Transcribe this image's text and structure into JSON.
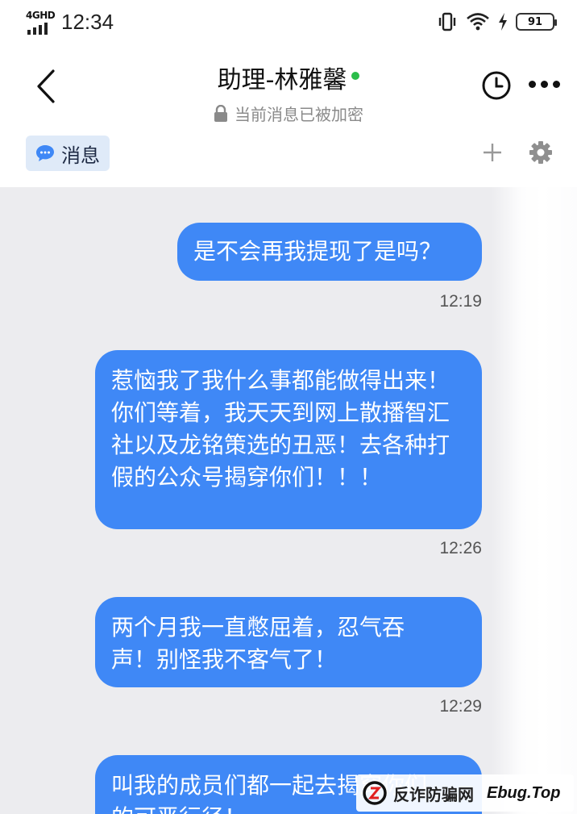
{
  "status_bar": {
    "network": "4GHD",
    "time": "12:34",
    "battery": "91"
  },
  "header": {
    "title": "助理-林雅馨",
    "subtitle": "当前消息已被加密"
  },
  "tabs": {
    "active_label": "消息"
  },
  "messages": [
    {
      "text": "是不会再我提现了是吗？",
      "time": "12:19"
    },
    {
      "text": "惹恼我了我什么事都能做得出来！你们等着，我天天到网上散播智汇社以及龙铭策选的丑恶！去各种打假的公众号揭穿你们！！！",
      "time": "12:26"
    },
    {
      "text": "两个月我一直憋屈着，忍气吞声！别怪我不客气了！",
      "time": "12:29"
    },
    {
      "text": "叫我的成员们都一起去揭穿你们的可恶行径！",
      "time": ""
    }
  ],
  "watermark": {
    "site_name": "反诈防骗网",
    "domain": "Ebug.Top"
  },
  "colors": {
    "bubble": "#3f88f6",
    "chat_bg": "#ececef",
    "online": "#2bbd4a",
    "tab_bg": "#dfeaf8"
  }
}
